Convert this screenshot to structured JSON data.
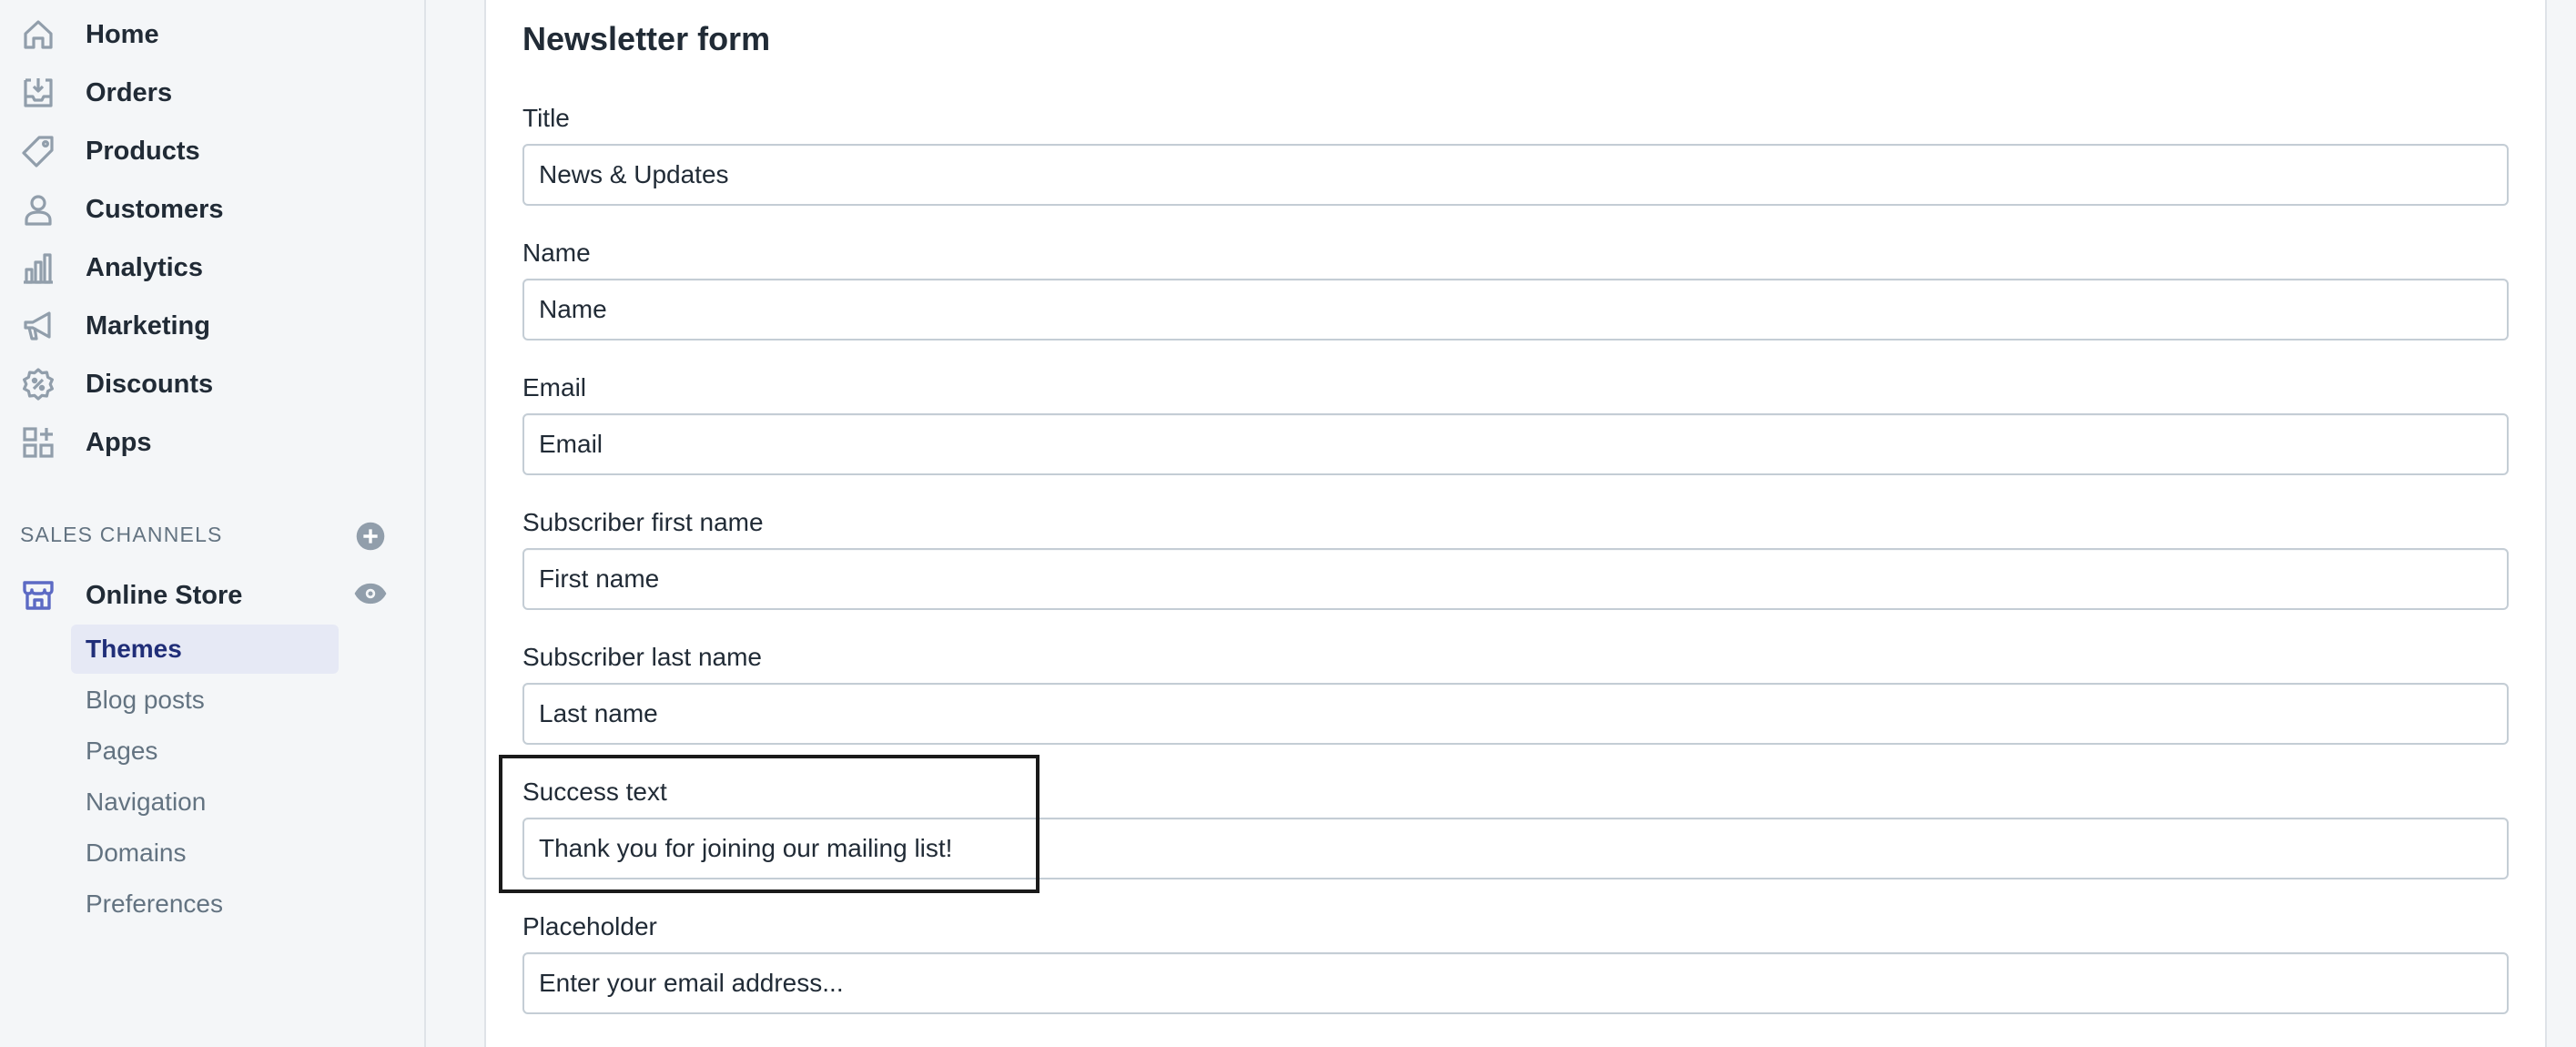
{
  "sidebar": {
    "nav": [
      {
        "label": "Home",
        "icon": "home-icon"
      },
      {
        "label": "Orders",
        "icon": "orders-inbox-icon"
      },
      {
        "label": "Products",
        "icon": "tag-icon"
      },
      {
        "label": "Customers",
        "icon": "person-icon"
      },
      {
        "label": "Analytics",
        "icon": "bar-chart-icon"
      },
      {
        "label": "Marketing",
        "icon": "megaphone-icon"
      },
      {
        "label": "Discounts",
        "icon": "discount-badge-icon"
      },
      {
        "label": "Apps",
        "icon": "apps-grid-icon"
      }
    ],
    "sales_channels_title": "SALES CHANNELS",
    "online_store": {
      "label": "Online Store",
      "icon": "store-icon"
    },
    "sub_items": [
      "Themes",
      "Blog posts",
      "Pages",
      "Navigation",
      "Domains",
      "Preferences"
    ],
    "active_sub_item": "Themes"
  },
  "form": {
    "title": "Newsletter form",
    "fields": [
      {
        "label": "Title",
        "value": "News & Updates"
      },
      {
        "label": "Name",
        "value": "Name"
      },
      {
        "label": "Email",
        "value": "Email"
      },
      {
        "label": "Subscriber first name",
        "value": "First name"
      },
      {
        "label": "Subscriber last name",
        "value": "Last name"
      },
      {
        "label": "Success text",
        "value": "Thank you for joining our mailing list!"
      },
      {
        "label": "Placeholder",
        "value": "Enter your email address..."
      }
    ]
  },
  "colors": {
    "icon": "#919eab",
    "store_icon": "#5c6ac4",
    "active_bg": "#e6e9f5",
    "active_text": "#202e78"
  }
}
